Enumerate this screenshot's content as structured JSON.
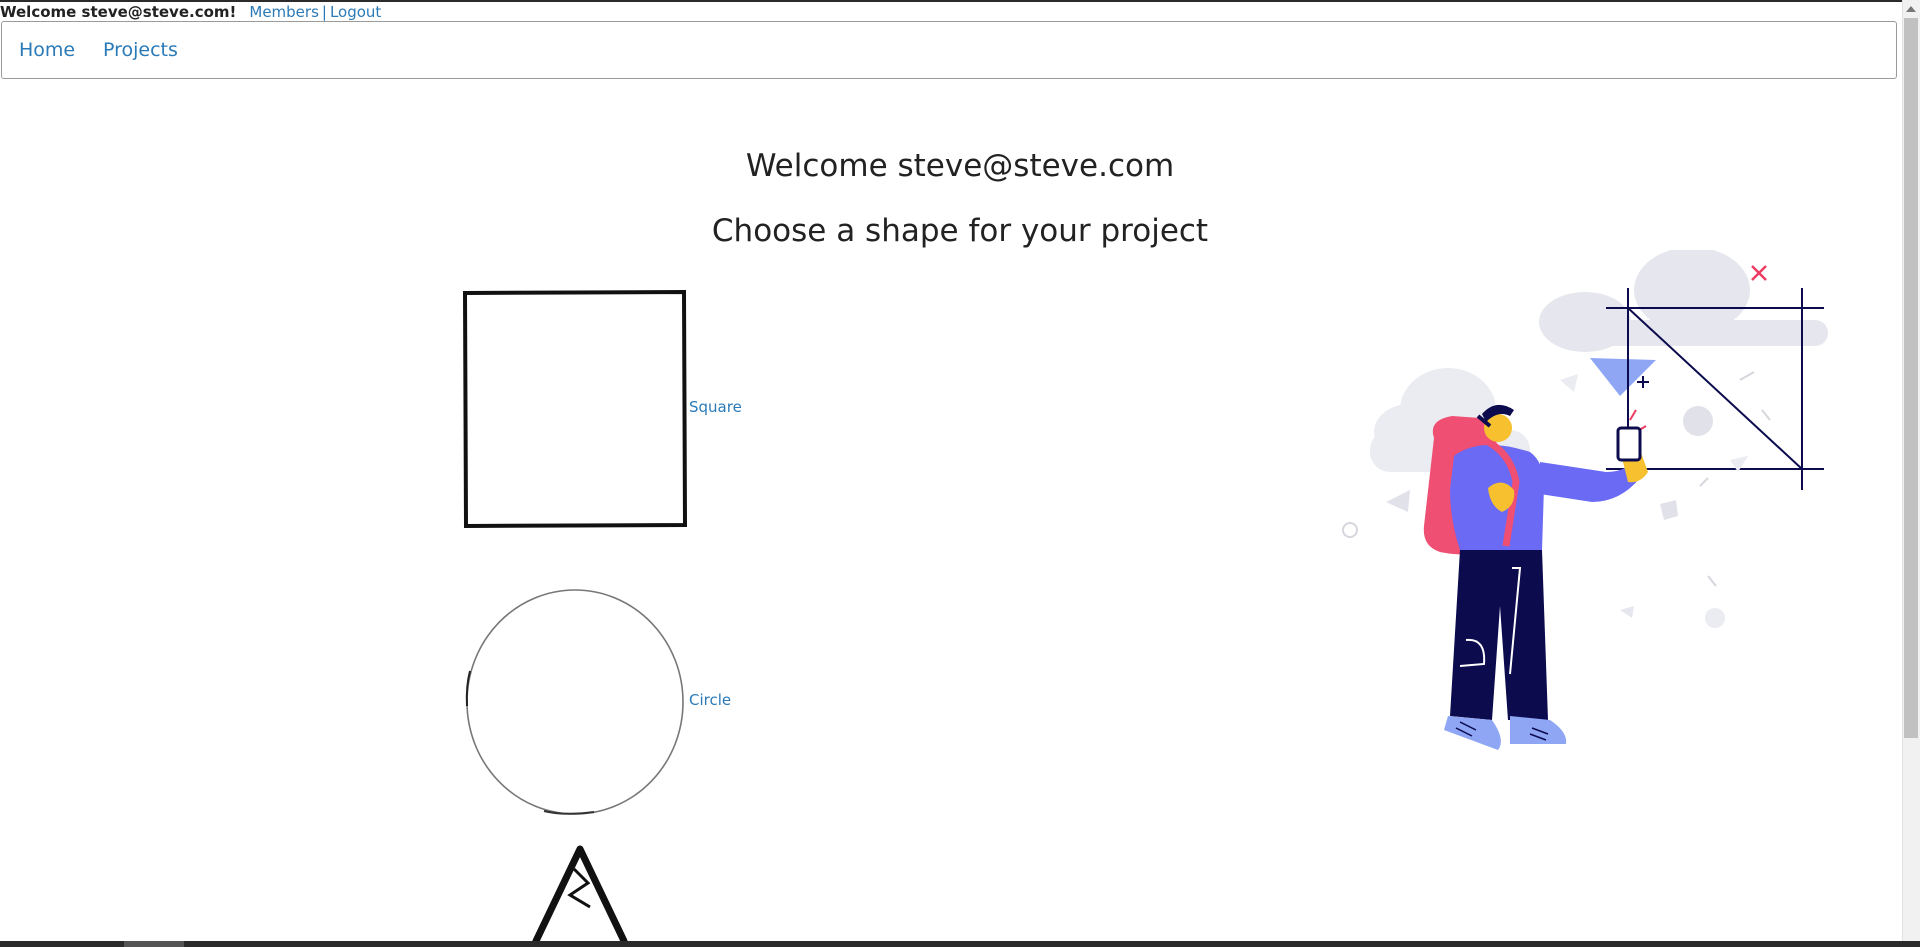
{
  "userbar": {
    "welcome": "Welcome steve@steve.com!",
    "members": "Members",
    "separator": "|",
    "logout": "Logout"
  },
  "nav": {
    "home": "Home",
    "projects": "Projects"
  },
  "main": {
    "title": "Welcome steve@steve.com",
    "subtitle": "Choose a shape for your project"
  },
  "shapes": [
    {
      "label": "Square"
    },
    {
      "label": "Circle"
    }
  ],
  "icons": {
    "illustration": "person-with-phone-illustration",
    "square": "square-shape-icon",
    "circle": "circle-shape-icon",
    "triangle": "triangle-shape-icon"
  },
  "colors": {
    "link": "#2a7ab8",
    "text": "#222222"
  }
}
